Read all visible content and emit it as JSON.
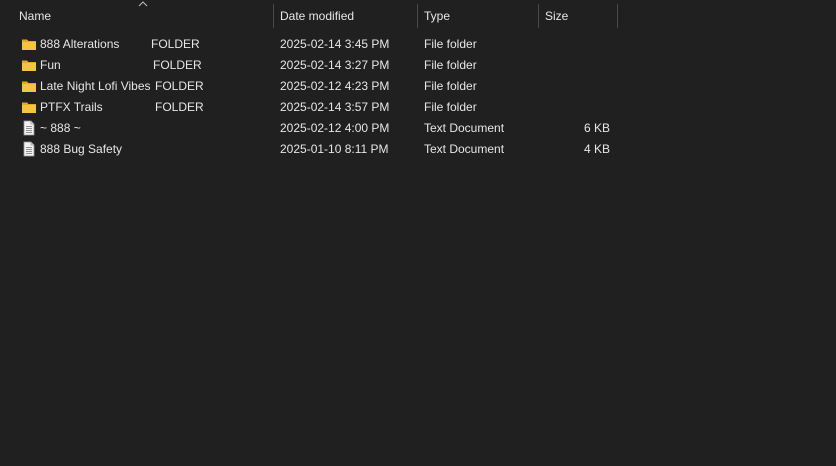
{
  "columns": {
    "name": "Name",
    "date": "Date modified",
    "type": "Type",
    "size": "Size"
  },
  "sort": {
    "column": "name",
    "arrow": "^"
  },
  "colors": {
    "background": "#202020",
    "text": "#e6e6e6",
    "folder_body": "#f4c543",
    "folder_tab": "#e5a823",
    "document": "#f2f2f2"
  },
  "files": [
    {
      "icon": "folder-icon",
      "name": "888 Alterations",
      "extra": "FOLDER",
      "date": "2025-02-14 3:45 PM",
      "type": "File folder",
      "size": ""
    },
    {
      "icon": "folder-icon",
      "name": "Fun",
      "extra": "FOLDER",
      "date": "2025-02-14 3:27 PM",
      "type": "File folder",
      "size": ""
    },
    {
      "icon": "folder-icon",
      "name": "Late Night Lofi Vibes",
      "extra": "FOLDER",
      "date": "2025-02-12 4:23 PM",
      "type": "File folder",
      "size": ""
    },
    {
      "icon": "folder-icon",
      "name": "PTFX Trails",
      "extra": "FOLDER",
      "date": "2025-02-14 3:57 PM",
      "type": "File folder",
      "size": ""
    },
    {
      "icon": "text-document-icon",
      "name": "~ 888 ~",
      "extra": "",
      "date": "2025-02-12 4:00 PM",
      "type": "Text Document",
      "size": "6 KB"
    },
    {
      "icon": "text-document-icon",
      "name": "888 Bug Safety",
      "extra": "",
      "date": "2025-01-10 8:11 PM",
      "type": "Text Document",
      "size": "4 KB"
    }
  ]
}
